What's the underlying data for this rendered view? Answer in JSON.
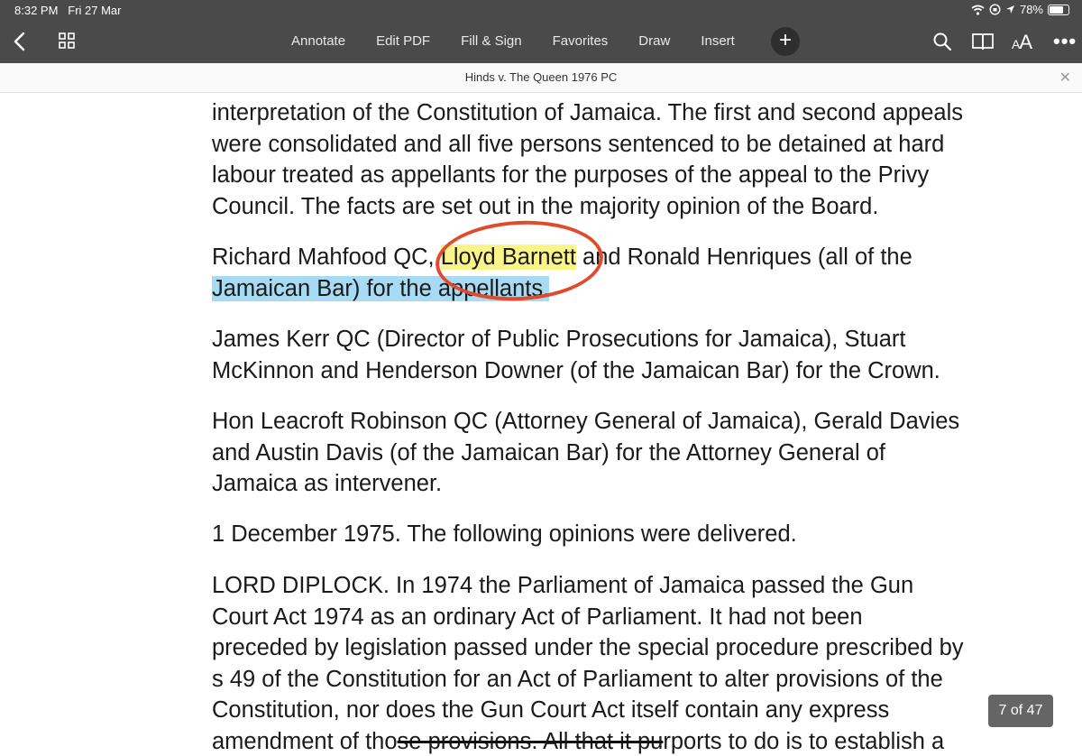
{
  "status_bar": {
    "time": "8:32 PM",
    "date": "Fri 27 Mar",
    "battery": "78%"
  },
  "toolbar": {
    "menu": [
      "Annotate",
      "Edit PDF",
      "Fill & Sign",
      "Favorites",
      "Draw",
      "Insert"
    ],
    "text_size_label": "AA"
  },
  "document": {
    "title": "Hinds v. The Queen 1976 PC"
  },
  "content": {
    "p1_lines": [
      "interpretation of the Constitution of Jamaica.  The first and second appeals",
      "were consolidated and all five persons sentenced to be detained at hard",
      "labour treated as appellants for the purposes of the appeal to the Privy",
      "Council.  The facts are set out in the majority opinion of the Board."
    ],
    "p2_start": "Richard Mahfood QC, ",
    "p2_highlight_yellow": "Lloyd Barnett",
    "p2_rest": " and Ronald Henriques (all of the",
    "p2_highlight_blue": "Jamaican Bar) for the appellants.",
    "p3_lines": [
      "James Kerr QC (Director of Public Prosecutions for Jamaica), Stuart",
      "McKinnon and Henderson Downer (of the Jamaican Bar) for the Crown."
    ],
    "p4_lines": [
      "Hon Leacroft Robinson QC (Attorney General of Jamaica), Gerald Davies",
      "and Austin Davis (of the Jamaican Bar) for the Attorney General of",
      "Jamaica as intervener."
    ],
    "p5": "1 December 1975.  The following opinions were delivered.",
    "p6_lines": [
      "LORD DIPLOCK.  In 1974 the Parliament of Jamaica passed the Gun",
      "Court Act 1974 as an ordinary Act of Parliament.  It had not been",
      "preceded by legislation passed under the special procedure prescribed by",
      "s 49 of the Constitution for an Act of Parliament to alter provisions of the",
      "Constitution, nor does the Gun Court Act itself contain any express"
    ],
    "p6_last_start": "amendment of tho",
    "p6_last_struck": "se provisions.  All that it pu",
    "p6_last_end": "rports to do is to establish a"
  },
  "page_indicator": "7 of 47",
  "colors": {
    "toolbar_bg": "#4a4a4a",
    "highlight_yellow": "#fbf489",
    "highlight_blue": "#a7daf3",
    "circle_annotation": "#e04b2e"
  }
}
